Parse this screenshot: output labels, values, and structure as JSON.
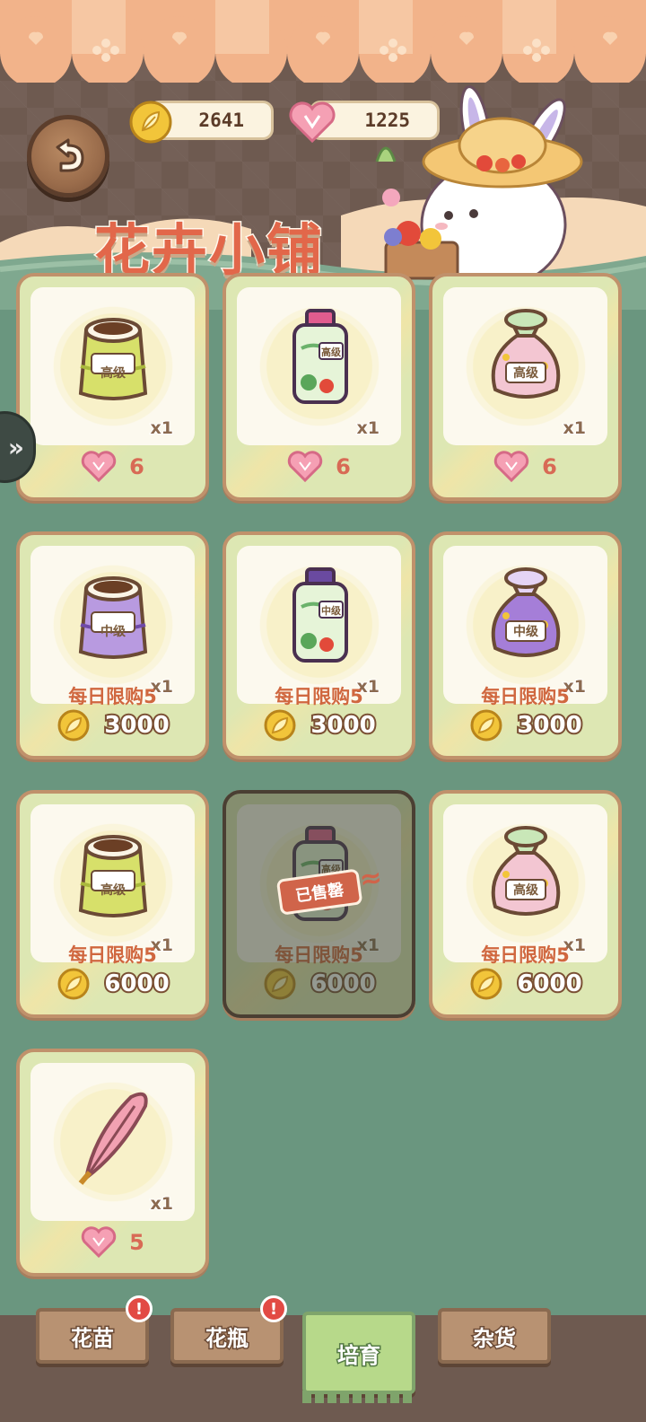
{
  "header": {
    "title": "花卉小铺",
    "leaf_currency": "2641",
    "heart_currency": "1225"
  },
  "colors": {
    "background": "#6a967f",
    "card_border": "#c0916b",
    "limit_text": "#d0673f",
    "tab_active": "#b7d98a"
  },
  "items": [
    {
      "icon": "soil-bag-advanced-icon",
      "qty": "x1",
      "limit": "",
      "price": "6",
      "currency": "heart"
    },
    {
      "icon": "fertilizer-bottle-advanced-icon",
      "qty": "x1",
      "limit": "",
      "price": "6",
      "currency": "heart"
    },
    {
      "icon": "seed-pouch-advanced-icon",
      "qty": "x1",
      "limit": "",
      "price": "6",
      "currency": "heart"
    },
    {
      "icon": "soil-bag-medium-icon",
      "qty": "x1",
      "limit": "每日限购5",
      "price": "3000",
      "currency": "leaf"
    },
    {
      "icon": "fertilizer-bottle-medium-icon",
      "qty": "x1",
      "limit": "每日限购5",
      "price": "3000",
      "currency": "leaf"
    },
    {
      "icon": "seed-pouch-medium-icon",
      "qty": "x1",
      "limit": "每日限购5",
      "price": "3000",
      "currency": "leaf"
    },
    {
      "icon": "soil-bag-advanced-icon",
      "qty": "x1",
      "limit": "每日限购5",
      "price": "6000",
      "currency": "leaf"
    },
    {
      "icon": "fertilizer-bottle-advanced-icon",
      "qty": "x1",
      "limit": "每日限购5",
      "price": "6000",
      "currency": "leaf",
      "sold_out": "已售罄"
    },
    {
      "icon": "seed-pouch-advanced-icon",
      "qty": "x1",
      "limit": "每日限购5",
      "price": "6000",
      "currency": "leaf"
    },
    {
      "icon": "feather-icon",
      "qty": "x1",
      "limit": "",
      "price": "5",
      "currency": "heart"
    }
  ],
  "item_labels": {
    "advanced": "高级",
    "medium": "中级"
  },
  "tabs": [
    {
      "label": "花苗",
      "badge": "!"
    },
    {
      "label": "花瓶",
      "badge": "!"
    },
    {
      "label": "培育",
      "badge": ""
    },
    {
      "label": "杂货",
      "badge": ""
    }
  ]
}
